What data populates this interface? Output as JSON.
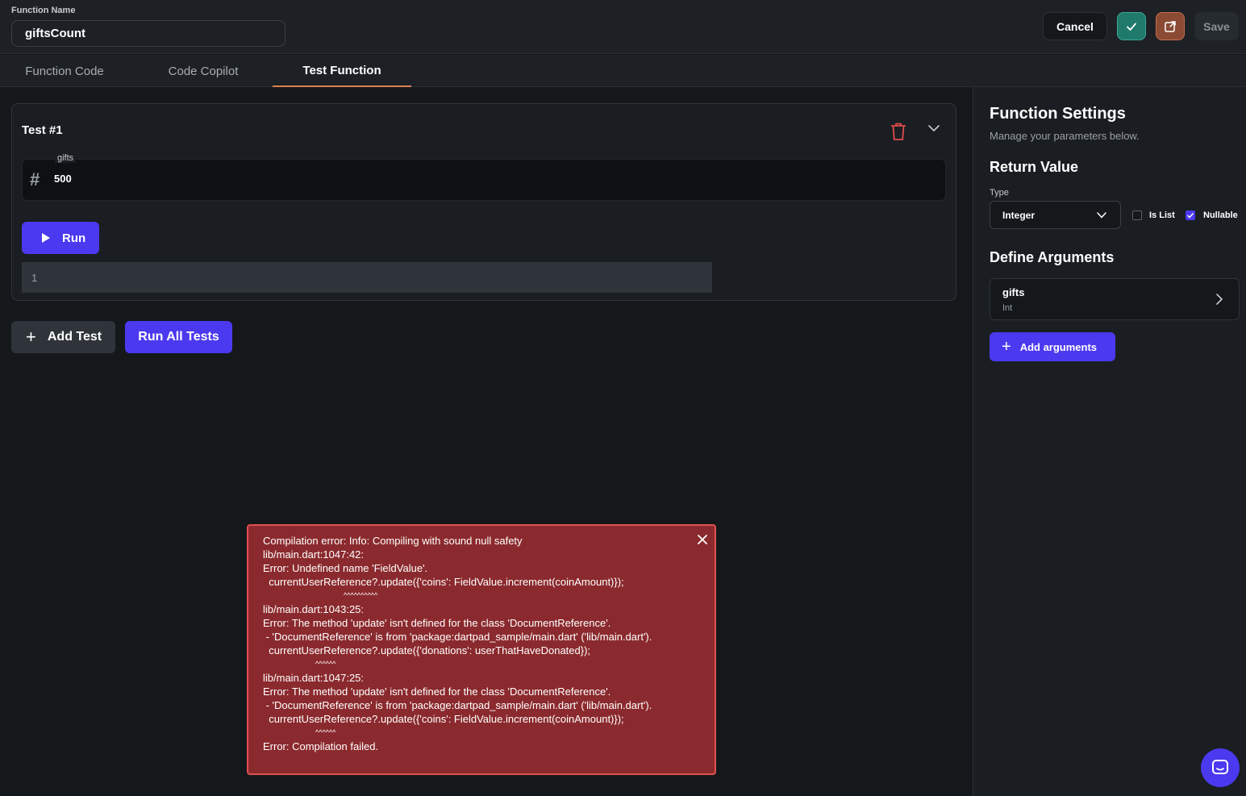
{
  "header": {
    "function_name_label": "Function Name",
    "function_name_value": "giftsCount",
    "cancel_label": "Cancel",
    "save_label": "Save",
    "confirm_icon": "check-icon",
    "external_icon": "external-link-icon"
  },
  "tabs": [
    {
      "label": "Function Code",
      "active": false
    },
    {
      "label": "Code Copilot",
      "active": false
    },
    {
      "label": "Test Function",
      "active": true
    }
  ],
  "test": {
    "title": "Test #1",
    "arg_label": "gifts",
    "arg_value": "500",
    "run_label": "Run",
    "result_line": "1"
  },
  "actions": {
    "add_test_label": "Add Test",
    "run_all_label": "Run All Tests"
  },
  "settings": {
    "title": "Function Settings",
    "subtitle": "Manage your parameters below.",
    "return_value_heading": "Return Value",
    "type_label": "Type",
    "type_value": "Integer",
    "is_list_label": "Is List",
    "is_list_checked": false,
    "nullable_label": "Nullable",
    "nullable_checked": true,
    "define_args_heading": "Define Arguments",
    "arguments": [
      {
        "name": "gifts",
        "type": "Int"
      }
    ],
    "add_arguments_label": "Add arguments"
  },
  "error": {
    "lines": [
      "Compilation error: Info: Compiling with sound null safety",
      "lib/main.dart:1047:42:",
      "Error: Undefined name 'FieldValue'.",
      "  currentUserReference?.update({'coins': FieldValue.increment(coinAmount)});",
      "                                        ^^^^^^^^^^",
      "lib/main.dart:1043:25:",
      "Error: The method 'update' isn't defined for the class 'DocumentReference'.",
      " - 'DocumentReference' is from 'package:dartpad_sample/main.dart' ('lib/main.dart').",
      "  currentUserReference?.update({'donations': userThatHaveDonated});",
      "                          ^^^^^^",
      "lib/main.dart:1047:25:",
      "Error: The method 'update' isn't defined for the class 'DocumentReference'.",
      " - 'DocumentReference' is from 'package:dartpad_sample/main.dart' ('lib/main.dart').",
      "  currentUserReference?.update({'coins': FieldValue.increment(coinAmount)});",
      "                          ^^^^^^",
      "Error: Compilation failed."
    ]
  },
  "colors": {
    "accent": "#4b39ef",
    "error_bg": "#8b2a2e",
    "tab_underline": "#e07f4f",
    "trash": "#e04a4a"
  }
}
